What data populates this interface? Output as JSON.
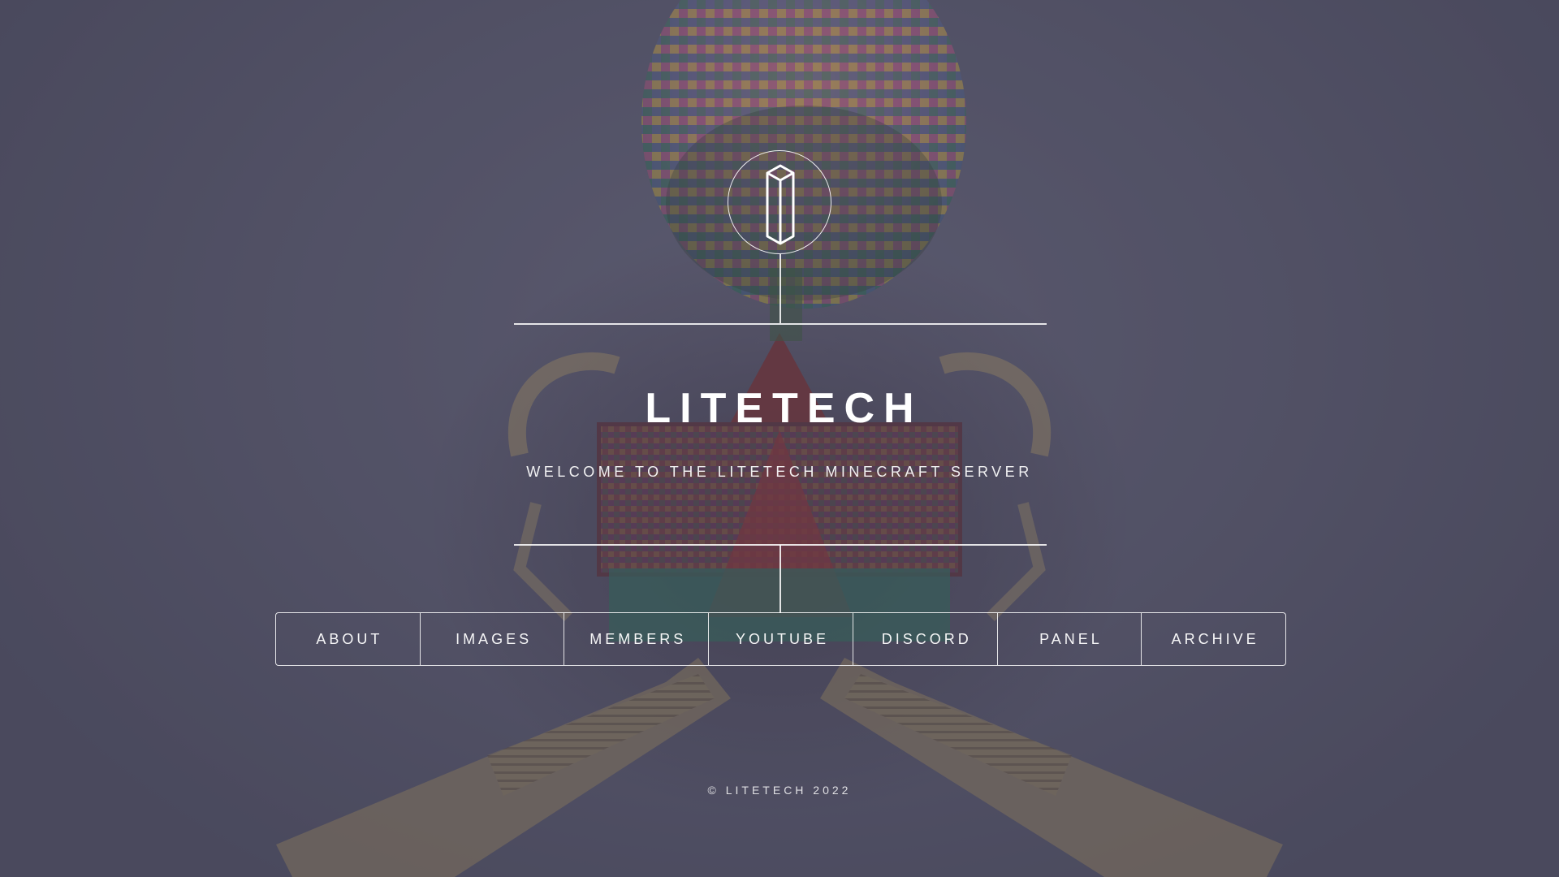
{
  "header": {
    "title": "LITETECH",
    "subtitle": "WELCOME TO THE LITETECH MINECRAFT SERVER"
  },
  "logo": {
    "icon": "hexagonal-pillar-icon"
  },
  "nav": {
    "items": [
      {
        "label": "ABOUT"
      },
      {
        "label": "IMAGES"
      },
      {
        "label": "MEMBERS"
      },
      {
        "label": "YOUTUBE"
      },
      {
        "label": "DISCORD"
      },
      {
        "label": "PANEL"
      },
      {
        "label": "ARCHIVE"
      }
    ]
  },
  "footer": {
    "text": "© LITETECH 2022"
  },
  "colors": {
    "overlay": "#5c5a6a",
    "foreground": "#ffffff"
  }
}
